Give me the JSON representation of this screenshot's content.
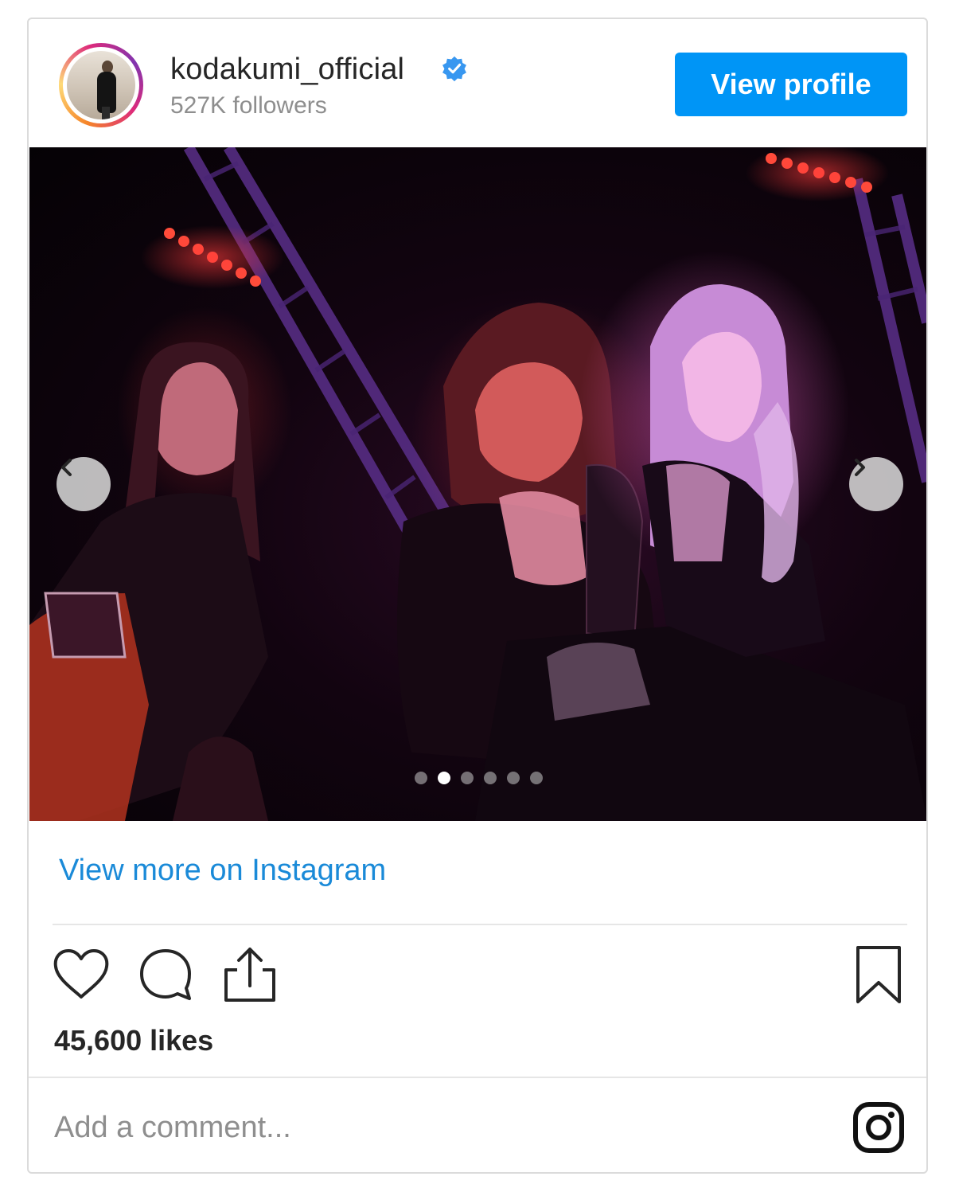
{
  "header": {
    "username": "kodakumi_official",
    "followers": "527K followers",
    "view_profile_label": "View profile",
    "verified_color": "#3897f0"
  },
  "media": {
    "slide_count": 6,
    "active_slide": 2,
    "prev_icon": "chevron-left-icon",
    "next_icon": "chevron-right-icon"
  },
  "links": {
    "view_more": "View more on Instagram"
  },
  "actions": {
    "icons": [
      "heart-icon",
      "comment-icon",
      "share-icon",
      "bookmark-icon"
    ]
  },
  "stats": {
    "likes": "45,600 likes"
  },
  "comment": {
    "placeholder": "Add a comment..."
  },
  "colors": {
    "accent": "#0095f6",
    "link": "#1a8ad8",
    "muted": "#8e8e8e"
  }
}
